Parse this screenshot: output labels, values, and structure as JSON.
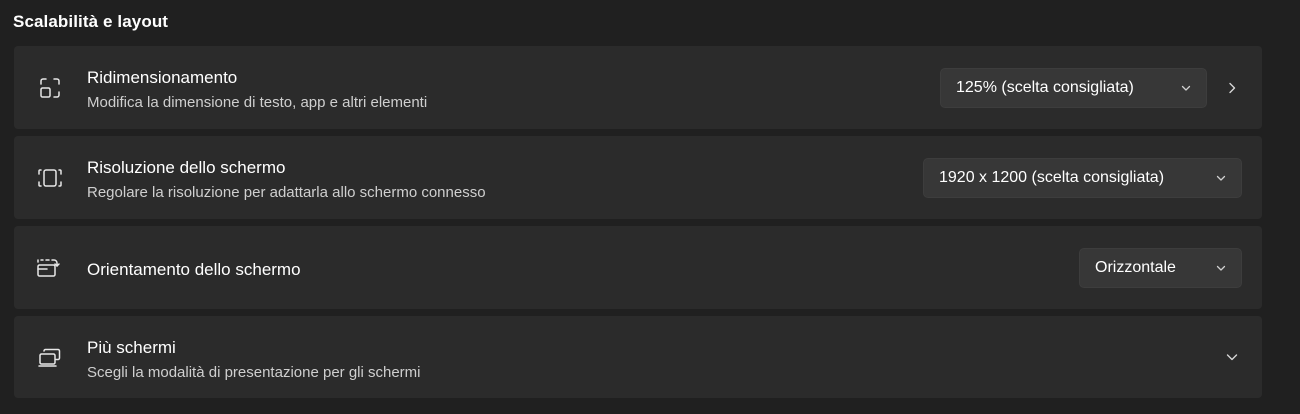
{
  "section": {
    "title": "Scalabilità e layout"
  },
  "cards": [
    {
      "icon": "scale-icon",
      "title": "Ridimensionamento",
      "description": "Modifica la dimensione di testo, app e altri elementi",
      "dropdown_value": "125% (scelta consigliata)",
      "trailing": "chevron-right-icon"
    },
    {
      "icon": "resolution-icon",
      "title": "Risoluzione dello schermo",
      "description": "Regolare la risoluzione per adattarla allo schermo connesso",
      "dropdown_value": "1920 x 1200 (scelta consigliata)"
    },
    {
      "icon": "orientation-icon",
      "title": "Orientamento dello schermo",
      "dropdown_value": "Orizzontale"
    },
    {
      "icon": "multiple-displays-icon",
      "title": "Più schermi",
      "description": "Scegli la modalità di presentazione per gli schermi",
      "trailing": "chevron-down-icon"
    }
  ],
  "colors": {
    "background": "#202020",
    "card": "#2b2b2b",
    "dropdown": "#373737",
    "secondary_text": "#cfcfcf"
  }
}
